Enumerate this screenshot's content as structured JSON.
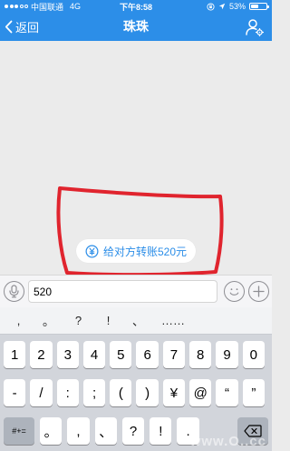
{
  "status_bar": {
    "carrier": "中国联通",
    "network": "4G",
    "time": "下午8:58",
    "battery": "53%",
    "battery_level": 0.53
  },
  "nav": {
    "back_label": "返回",
    "title": "珠珠"
  },
  "chat": {
    "transfer_suggestion": "给对方转账520元"
  },
  "input": {
    "value": "520"
  },
  "keyboard": {
    "suggestions": [
      ",",
      "。",
      "?",
      "!",
      "、",
      "……"
    ],
    "row1": [
      "1",
      "2",
      "3",
      "4",
      "5",
      "6",
      "7",
      "8",
      "9",
      "0"
    ],
    "row2": [
      "-",
      "/",
      ":",
      ";",
      "(",
      ")",
      "¥",
      "@",
      "“",
      "”"
    ],
    "mode_key": "#+=",
    "row3": [
      "。",
      ",",
      "、",
      "?",
      "!",
      "."
    ]
  },
  "watermark": "www.O..cc",
  "colors": {
    "accent": "#2c8ee8",
    "annotation": "#e0242e"
  }
}
